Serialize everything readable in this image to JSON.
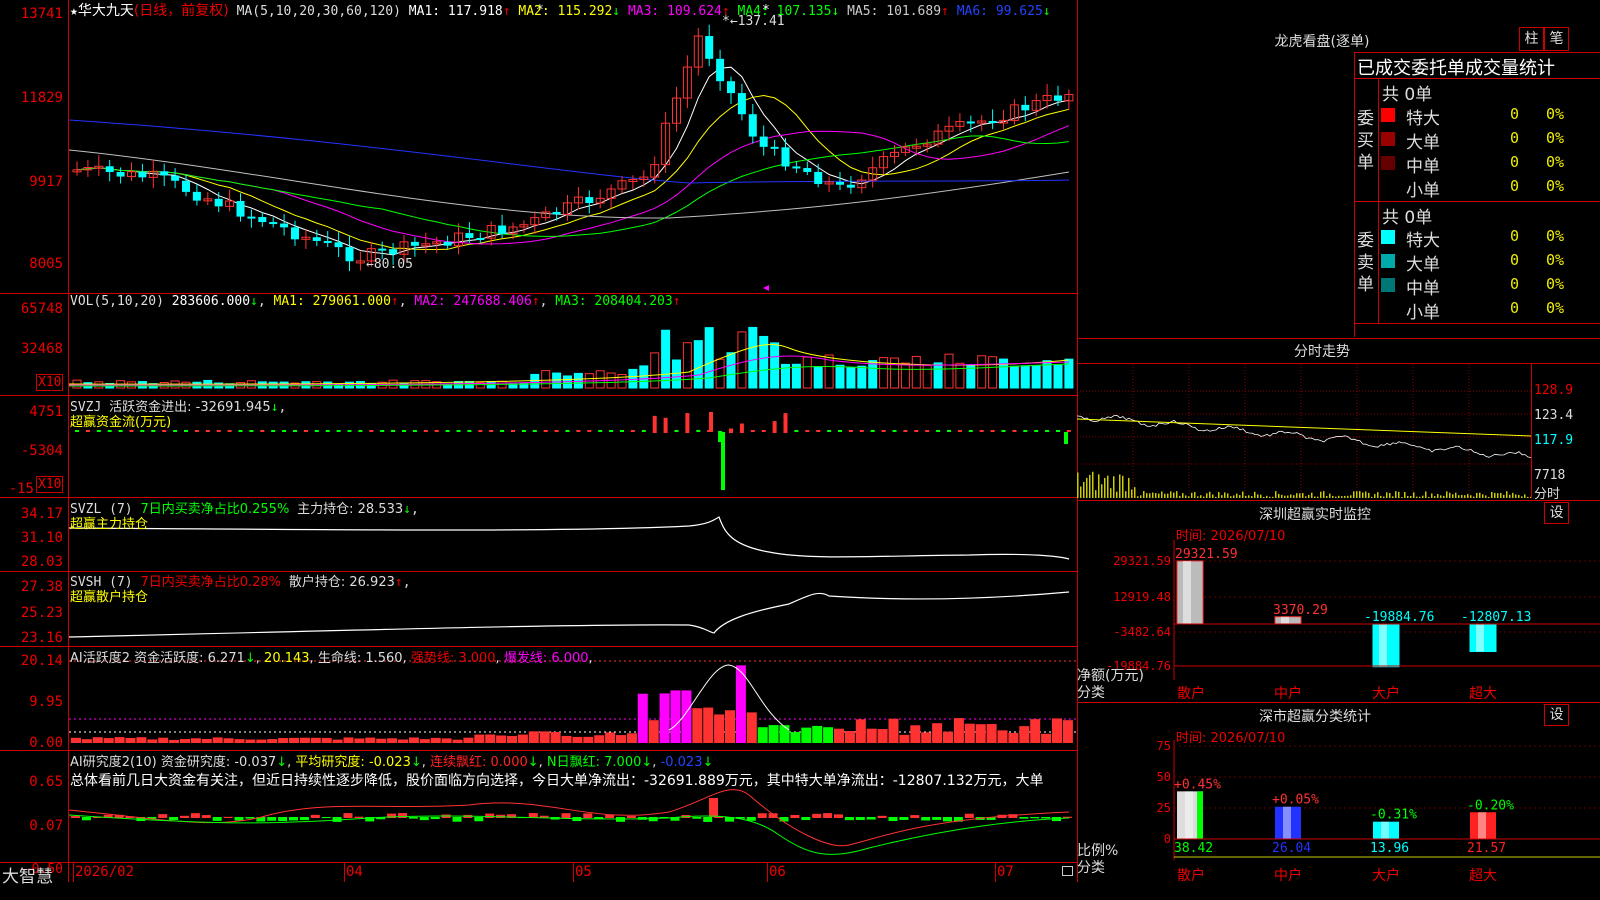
{
  "stock": {
    "name": "华大九天",
    "mode": "(日线，前复权)"
  },
  "ma_line": {
    "head": "MA(5,10,20,30,60,120)",
    "items": [
      {
        "label": "MA1: 117.918",
        "arrow": "↑",
        "color": "#ffffff"
      },
      {
        "label": "MA2: 115.292",
        "arrow": "↓",
        "color": "#ffff00"
      },
      {
        "label": "MA3: 109.624",
        "arrow": "↑",
        "color": "#ff00ff"
      },
      {
        "label": "MA4: 107.135",
        "arrow": "↓",
        "color": "#00ff00"
      },
      {
        "label": "MA5: 101.689",
        "arrow": "↑",
        "color": "#c0c0c0"
      },
      {
        "label": "MA6: 99.625",
        "arrow": "↓",
        "color": "#2244ff"
      }
    ]
  },
  "price_axis": [
    "13741",
    "11829",
    "9917",
    "8005"
  ],
  "price_annot": {
    "high": "137.41",
    "low": "80.05"
  },
  "vol_line": {
    "head": "VOL(5,10,20)",
    "value": "283606.000",
    "items": [
      {
        "label": "MA1: 279061.000",
        "arrow": "↑",
        "color": "#ffff00"
      },
      {
        "label": "MA2: 247688.406",
        "arrow": "↑",
        "color": "#ff00ff"
      },
      {
        "label": "MA3: 208404.203",
        "arrow": "↑",
        "color": "#00ff00"
      }
    ]
  },
  "vol_axis": [
    "65748",
    "32468"
  ],
  "x10": "X10",
  "svzj": {
    "head": "SVZJ",
    "label": "活跃资金进出: -32691.945",
    "arrow": "↓",
    "sub": "超赢资金流(万元)",
    "axis": [
      "4751",
      "-5304",
      "-15"
    ]
  },
  "svzl": {
    "head": "SVZL (7)",
    "desc": "7日内买卖净占比0.255%",
    "label": "主力持仓: 28.533",
    "arrow": "↓",
    "sub": "超赢主力持仓",
    "axis": [
      "34.17",
      "31.10",
      "28.03"
    ]
  },
  "svsh": {
    "head": "SVSH (7)",
    "desc": "7日内买卖净占比0.28%",
    "label": "散户持仓: 26.923",
    "arrow": "↑",
    "sub": "超赢散户持仓",
    "axis": [
      "27.38",
      "25.23",
      "23.16"
    ]
  },
  "ai1": {
    "head": "AI活跃度2",
    "a": "资金活跃度: 6.271",
    "b": "20.143",
    "c": "生命线: 1.560",
    "d": "强势线: 3.000",
    "e": "爆发线: 6.000",
    "axis": [
      "20.14",
      "9.95",
      "0.00"
    ]
  },
  "ai2": {
    "head": "AI研究度2(10)",
    "a": "资金研究度: -0.037",
    "b": "平均研究度: -0.023",
    "c": "连续飘红: 0.000",
    "d": "N日飘红: 7.000",
    "e": "-0.023",
    "axis": [
      "0.65",
      "0.07",
      "-0.50"
    ]
  },
  "summary": "总体看前几日大资金有关注，但近日持续性逐步降低，股价面临方向选择，今日大单净流出：-32691.889万元，其中特大单净流出：-12807.132万元，大单",
  "bottom": {
    "brand": "大智慧",
    "dates": [
      "2026/02",
      "04",
      "05",
      "06",
      "07"
    ]
  },
  "lhb": {
    "title": "龙虎看盘(逐单)",
    "btn1": "柱",
    "btn2": "笔",
    "tabs": "已成交委托单成交量统计",
    "buy": {
      "side": "委买单",
      "total": "共 0单",
      "rows": [
        {
          "label": "特大",
          "value": "0",
          "pct": "0%",
          "color": "#ff0000"
        },
        {
          "label": "大单",
          "value": "0",
          "pct": "0%",
          "color": "#990000"
        },
        {
          "label": "中单",
          "value": "0",
          "pct": "0%",
          "color": "#660000"
        },
        {
          "label": "小单",
          "value": "0",
          "pct": "0%",
          "color": ""
        }
      ]
    },
    "sell": {
      "side": "委卖单",
      "total": "共 0单",
      "rows": [
        {
          "label": "特大",
          "value": "0",
          "pct": "0%",
          "color": "#00ffff"
        },
        {
          "label": "大单",
          "value": "0",
          "pct": "0%",
          "color": "#00aaaa"
        },
        {
          "label": "中单",
          "value": "0",
          "pct": "0%",
          "color": "#007777"
        },
        {
          "label": "小单",
          "value": "0",
          "pct": "0%",
          "color": ""
        }
      ]
    }
  },
  "fenshi": {
    "title": "分时走势",
    "axis": [
      "128.9",
      "123.4",
      "117.9",
      "7718"
    ],
    "unit": "分时"
  },
  "monitor": {
    "title": "深圳超赢实时监控",
    "btn": "设",
    "time": "时间: 2026/07/10",
    "axis": [
      "29321.59",
      "12919.48",
      "-3482.64",
      "-19884.76"
    ],
    "ylabel": "净额(万元)",
    "xlabel": "分类",
    "bars": [
      {
        "cat": "散户",
        "value": 29321.59,
        "label": "29321.59"
      },
      {
        "cat": "中户",
        "value": 3370.29,
        "label": "3370.29"
      },
      {
        "cat": "大户",
        "value": -19884.76,
        "label": "-19884.76"
      },
      {
        "cat": "超大",
        "value": -12807.13,
        "label": "-12807.13"
      }
    ]
  },
  "classify": {
    "title": "深市超赢分类统计",
    "btn": "设",
    "time": "时间: 2026/07/10",
    "axis": [
      "75",
      "50",
      "25",
      "0"
    ],
    "ylabel": "比例%",
    "xlabel": "分类",
    "bars": [
      {
        "cat": "散户",
        "value": 38.42,
        "label": "38.42",
        "delta": "+0.45%",
        "color": "#dddddd"
      },
      {
        "cat": "中户",
        "value": 26.04,
        "label": "26.04",
        "delta": "+0.05%",
        "color": "#2233ff"
      },
      {
        "cat": "大户",
        "value": 13.96,
        "label": "13.96",
        "delta": "-0.31%",
        "color": "#00ffff"
      },
      {
        "cat": "超大",
        "value": 21.57,
        "label": "21.57",
        "delta": "-0.20%",
        "color": "#ff2222"
      }
    ]
  }
}
